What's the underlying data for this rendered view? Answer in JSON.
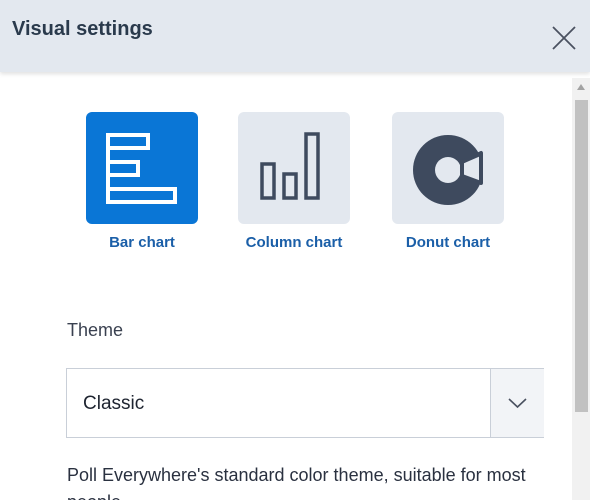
{
  "header": {
    "title": "Visual settings",
    "close_icon": "close-icon"
  },
  "chart_types": [
    {
      "label": "Bar chart",
      "icon": "bar-chart-icon",
      "selected": true
    },
    {
      "label": "Column chart",
      "icon": "column-chart-icon",
      "selected": false
    },
    {
      "label": "Donut chart",
      "icon": "donut-chart-icon",
      "selected": false
    }
  ],
  "theme": {
    "label": "Theme",
    "selected": "Classic",
    "dropdown_icon": "chevron-down-icon",
    "description": "Poll Everywhere's standard color theme, suitable for most people"
  },
  "colors": {
    "accent": "#0a76d6",
    "header_bg": "#e3e8ef",
    "tile_bg": "#e3e8ef",
    "label_blue": "#1b5fa8",
    "icon_dark": "#3e4a5e"
  }
}
